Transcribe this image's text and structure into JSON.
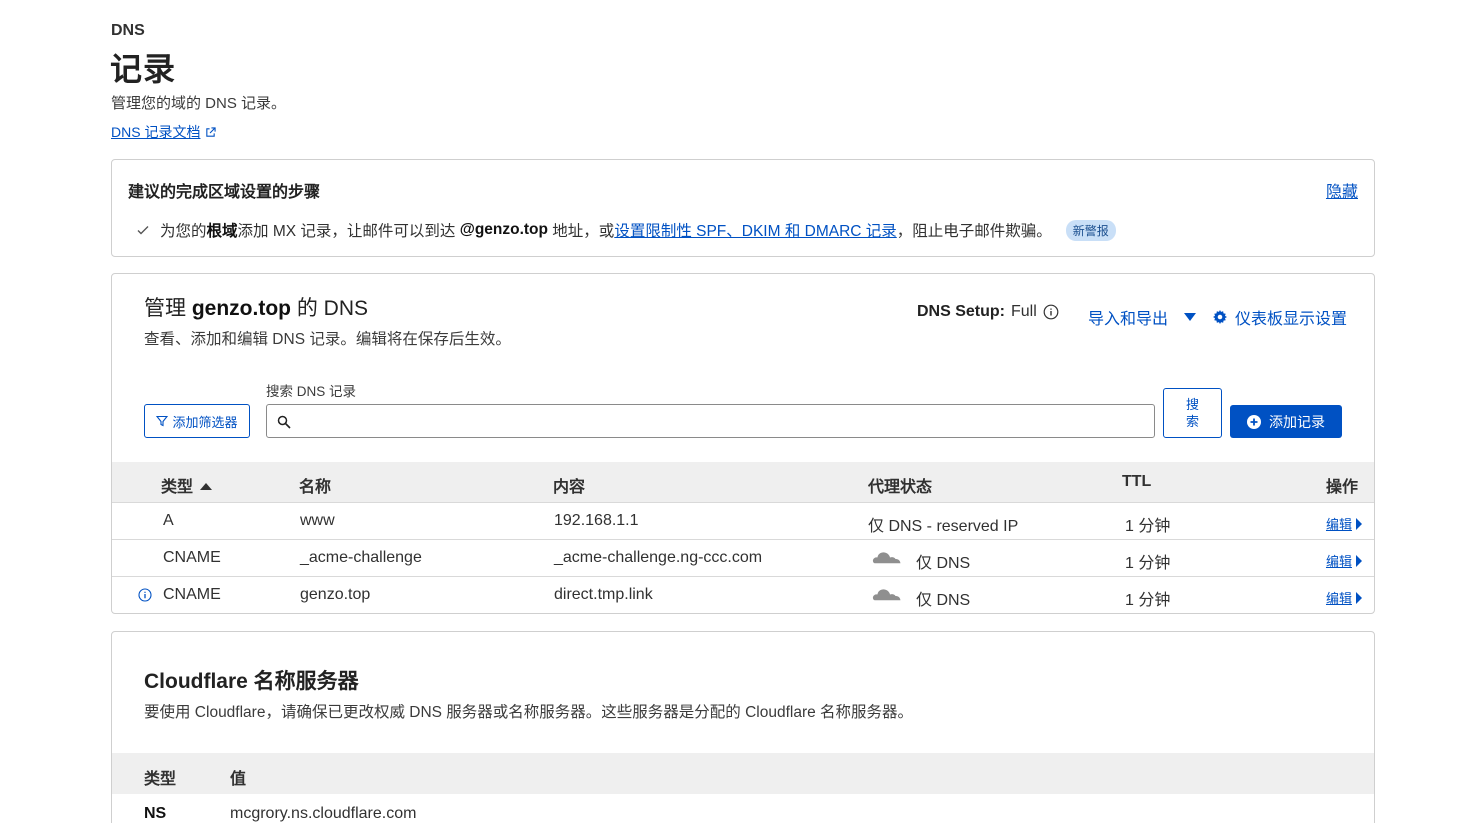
{
  "header": {
    "section": "DNS",
    "title": "记录",
    "subtitle": "管理您的域的 DNS 记录。",
    "doc_link": "DNS 记录文档"
  },
  "steps_card": {
    "title": "建议的完成区域设置的步骤",
    "hide": "隐藏",
    "step": {
      "t1": "为您的",
      "t2": "根域",
      "t3": "添加 MX 记录，让邮件可以到达 ",
      "t4": "@genzo.top",
      "t5": " 地址，或",
      "link": "设置限制性 SPF、DKIM 和 DMARC 记录",
      "t6": "，阻止电子邮件欺骗。",
      "badge": "新警报"
    }
  },
  "dns_card": {
    "title_prefix": "管理 ",
    "title_domain": "genzo.top",
    "title_suffix": " 的 DNS",
    "subtitle": "查看、添加和编辑 DNS 记录。编辑将在保存后生效。",
    "setup_label": "DNS Setup:",
    "setup_value": "Full",
    "import_export": "导入和导出",
    "dashboard_settings": "仪表板显示设置",
    "filter_button": "添加筛选器",
    "search_label": "搜索 DNS 记录",
    "search_placeholder": "",
    "search_button_line1": "搜",
    "search_button_line2": "索",
    "add_record": "添加记录",
    "columns": {
      "type": "类型",
      "name": "名称",
      "content": "内容",
      "proxy": "代理状态",
      "ttl": "TTL",
      "actions": "操作"
    },
    "records": [
      {
        "type": "A",
        "name": "www",
        "content": "192.168.1.1",
        "proxy": "仅 DNS - reserved IP",
        "ttl": "1 分钟",
        "edit": "编辑"
      },
      {
        "type": "CNAME",
        "name": "_acme-challenge",
        "content": "_acme-challenge.ng-ccc.com",
        "proxy": "仅 DNS",
        "ttl": "1 分钟",
        "edit": "编辑"
      },
      {
        "type": "CNAME",
        "name": "genzo.top",
        "content": "direct.tmp.link",
        "proxy": "仅 DNS",
        "ttl": "1 分钟",
        "edit": "编辑"
      }
    ]
  },
  "ns_card": {
    "title": "Cloudflare 名称服务器",
    "subtitle": "要使用 Cloudflare，请确保已更改权威 DNS 服务器或名称服务器。这些服务器是分配的 Cloudflare 名称服务器。",
    "col_type": "类型",
    "col_value": "值",
    "rows": [
      {
        "type": "NS",
        "value": "mcgrory.ns.cloudflare.com"
      }
    ]
  },
  "colors": {
    "accent": "#0051c3",
    "badge_bg": "#c9dff7",
    "table_header_bg": "#efefef",
    "border": "#cfcfcf"
  },
  "icons": [
    "external-link-icon",
    "check-icon",
    "info-icon",
    "chevron-down-icon",
    "gear-icon",
    "filter-icon",
    "search-icon",
    "plus-circle-icon",
    "sort-ascending-icon",
    "cloud-grey-icon",
    "chevron-right-icon"
  ]
}
